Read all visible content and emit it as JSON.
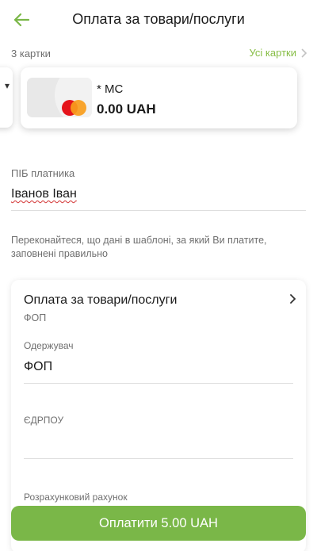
{
  "header": {
    "title": "Оплата за товари/послуги",
    "back_icon": "arrow-left-icon"
  },
  "colors": {
    "accent": "#7ab748",
    "link": "#86bd45",
    "mastercard_red": "#e5141b",
    "mastercard_orange": "#f89d1c"
  },
  "cards": {
    "count_label": "3 картки",
    "all_cards_label": "Усі картки",
    "selected": {
      "name": "* MC",
      "balance": "0.00 UAH"
    }
  },
  "payer": {
    "label": "ПІБ платника",
    "value": "Іванов Іван"
  },
  "note": "Переконайтеся, що дані в шаблоні, за який Ви платите, заповнені правильно",
  "template": {
    "title": "Оплата за товари/послуги",
    "subtitle": "ФОП",
    "fields": [
      {
        "label": "Одержувач",
        "value": "ФОП"
      },
      {
        "label": "ЄДРПОУ",
        "value": ""
      },
      {
        "label": "Розрахунковий рахунок",
        "value": ""
      }
    ]
  },
  "pay_button": {
    "label": "Оплатити 5.00 UAH"
  }
}
